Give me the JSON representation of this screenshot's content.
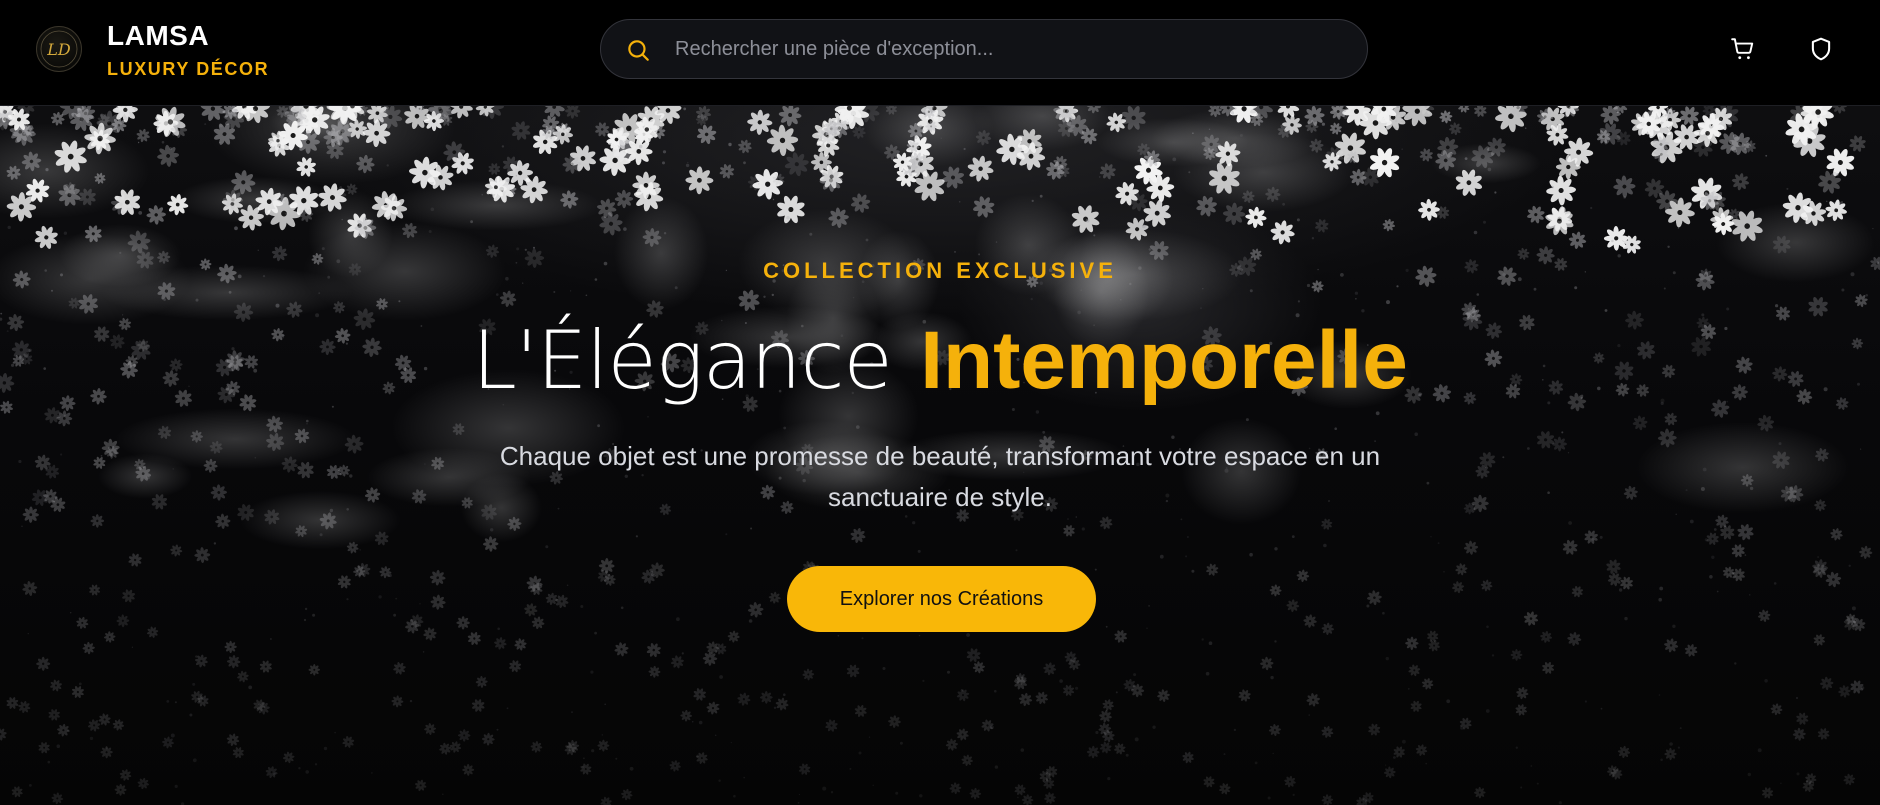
{
  "header": {
    "logo_text": "LD",
    "brand_name": "LAMSA",
    "brand_tagline": "LUXURY DÉCOR",
    "search": {
      "placeholder": "Rechercher une pièce d'exception...",
      "value": "",
      "icon": "search-icon"
    },
    "icons": [
      "cart-icon",
      "shield-icon"
    ]
  },
  "hero": {
    "eyebrow": "COLLECTION EXCLUSIVE",
    "title_light": "L'Élégance",
    "title_bold": "Intemporelle",
    "description": "Chaque objet est une promesse de beauté, transformant votre espace en un sanctuaire de style.",
    "cta_label": "Explorer nos Créations"
  },
  "colors": {
    "accent": "#f5b10b",
    "background": "#050505",
    "header_bg": "#000000",
    "search_bg": "#111216",
    "text_light": "#ffffff",
    "text_muted": "#d8dae0"
  }
}
